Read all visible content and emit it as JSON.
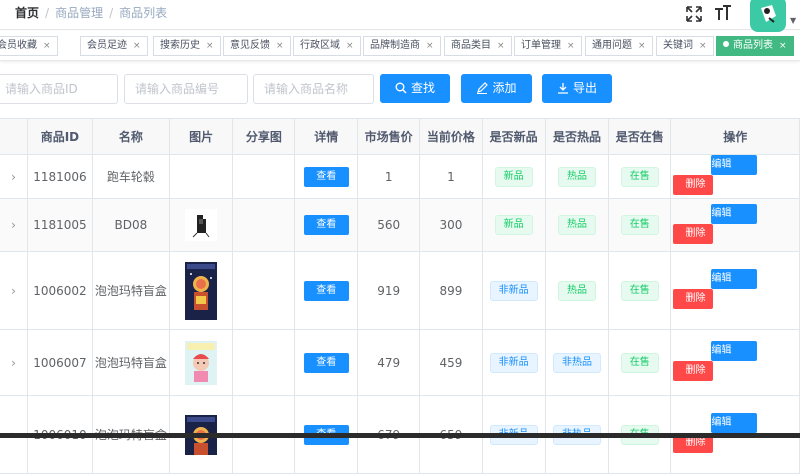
{
  "breadcrumb": {
    "home": "首页",
    "level2": "商品管理",
    "level3": "商品列表",
    "sep": "/"
  },
  "tags": [
    {
      "label": "会员收藏",
      "active": false
    },
    {
      "label": "会员足迹",
      "active": false
    },
    {
      "label": "搜索历史",
      "active": false
    },
    {
      "label": "意见反馈",
      "active": false
    },
    {
      "label": "行政区域",
      "active": false
    },
    {
      "label": "品牌制造商",
      "active": false
    },
    {
      "label": "商品类目",
      "active": false
    },
    {
      "label": "订单管理",
      "active": false
    },
    {
      "label": "通用问题",
      "active": false
    },
    {
      "label": "关键词",
      "active": false
    },
    {
      "label": "商品列表",
      "active": true
    }
  ],
  "tag_close": "×",
  "filters": {
    "goods_id_placeholder": "请输入商品ID",
    "goods_sn_placeholder": "请输入商品编号",
    "goods_name_placeholder": "请输入商品名称"
  },
  "buttons": {
    "search": "查找",
    "add": "添加",
    "export": "导出"
  },
  "table": {
    "headers": [
      "商品ID",
      "名称",
      "图片",
      "分享图",
      "详情",
      "市场售价",
      "当前价格",
      "是否新品",
      "是否热品",
      "是否在售",
      "操作"
    ],
    "detail_label": "查看",
    "edit_label": "编辑",
    "delete_label": "删除",
    "rows": [
      {
        "id": "1181006",
        "name": "跑车轮毂",
        "market_price": "1",
        "price": "1",
        "is_new": "新品",
        "is_hot": "热品",
        "on_sale": "在售",
        "image": "none"
      },
      {
        "id": "1181005",
        "name": "BD08",
        "market_price": "560",
        "price": "300",
        "is_new": "新品",
        "is_hot": "热品",
        "on_sale": "在售",
        "image": "device"
      },
      {
        "id": "1006002",
        "name": "泡泡玛特盲盒",
        "market_price": "919",
        "price": "899",
        "is_new": "非新品",
        "is_hot": "热品",
        "on_sale": "在售",
        "image": "box-dark"
      },
      {
        "id": "1006007",
        "name": "泡泡玛特盲盒",
        "market_price": "479",
        "price": "459",
        "is_new": "非新品",
        "is_hot": "非热品",
        "on_sale": "在售",
        "image": "box-light"
      },
      {
        "id": "1006010",
        "name": "泡泡玛特盲盒",
        "market_price": "679",
        "price": "659",
        "is_new": "非新品",
        "is_hot": "非热品",
        "on_sale": "在售",
        "image": "box-dark"
      }
    ]
  },
  "colors": {
    "primary": "#1890ff",
    "success": "#13ce66",
    "danger": "#ff4949",
    "tag_active": "#42b983",
    "avatar": "#3ccaa6"
  },
  "icons": {
    "fullscreen": "fullscreen-icon",
    "size": "font-size-icon",
    "search": "search-icon",
    "add": "edit-icon",
    "export": "download-icon",
    "expand": "chevron-right-icon"
  }
}
